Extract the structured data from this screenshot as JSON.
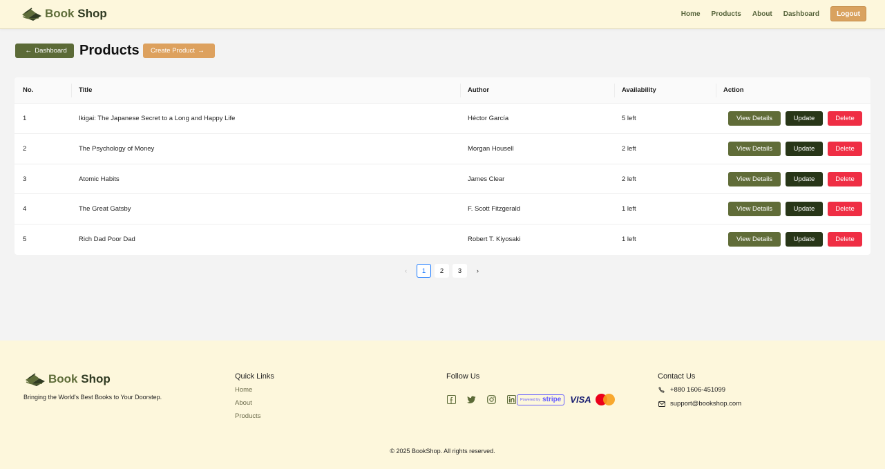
{
  "header": {
    "brand_part1": "Book",
    "brand_part2": "Shop",
    "nav": [
      "Home",
      "Products",
      "About",
      "Dashboard"
    ],
    "logout_label": "Logout"
  },
  "page": {
    "back_label": "Dashboard",
    "title": "Products",
    "create_label": "Create Product"
  },
  "table": {
    "columns": [
      "No.",
      "Title",
      "Author",
      "Availability",
      "Action"
    ],
    "rows": [
      {
        "no": "1",
        "title": "Ikigai: The Japanese Secret to a Long and Happy Life",
        "author": "Héctor García",
        "availability": "5 left"
      },
      {
        "no": "2",
        "title": "The Psychology of Money",
        "author": "Morgan Housell",
        "availability": "2 left"
      },
      {
        "no": "3",
        "title": "Atomic Habits",
        "author": "James Clear",
        "availability": "2 left"
      },
      {
        "no": "4",
        "title": "The Great Gatsby",
        "author": "F. Scott Fitzgerald",
        "availability": "1 left"
      },
      {
        "no": "5",
        "title": "Rich Dad Poor Dad",
        "author": "Robert T. Kiyosaki",
        "availability": "1 left"
      }
    ],
    "actions": {
      "view": "View Details",
      "update": "Update",
      "delete": "Delete"
    }
  },
  "pagination": {
    "prev_icon": "chevron-left-icon",
    "pages": [
      "1",
      "2",
      "3"
    ],
    "current": "1",
    "next_icon": "chevron-right-icon"
  },
  "footer": {
    "brand_part1": "Book",
    "brand_part2": "Shop",
    "tagline": "Bringing the World's Best Books to Your Doorstep.",
    "quick_links_heading": "Quick Links",
    "quick_links": [
      "Home",
      "About",
      "Products"
    ],
    "follow_heading": "Follow Us",
    "social_icons": [
      "facebook-icon",
      "twitter-icon",
      "instagram-icon",
      "linkedin-icon"
    ],
    "stripe_small": "Powered by",
    "stripe_big": "stripe",
    "visa": "VISA",
    "contact_heading": "Contact Us",
    "phone": "+880 1606-451099",
    "email": "support@bookshop.com",
    "copyright": "© 2025 BookShop. All rights reserved."
  },
  "colors": {
    "cream": "#fdf7dc",
    "olive": "#606c38",
    "dark_green": "#283618",
    "accent_orange": "#dda15e",
    "danger_red": "#ef2e44",
    "active_blue": "#1677ff"
  }
}
